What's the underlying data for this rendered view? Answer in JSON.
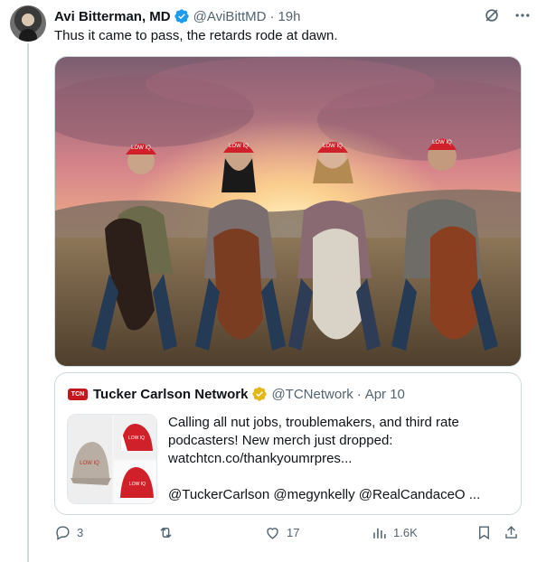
{
  "tweet": {
    "author_name": "Avi Bitterman, MD",
    "handle": "@AviBittMD",
    "separator": "·",
    "time": "19h",
    "text": "Thus it came to pass, the retards rode at dawn.",
    "image_hat_text": "LOW IQ"
  },
  "quote": {
    "logo_text": "TCN",
    "author_name": "Tucker Carlson Network",
    "handle": "@TCNetwork",
    "separator": "·",
    "date": "Apr 10",
    "text": "Calling all nut jobs, troublemakers, and third rate podcasters! New merch just dropped: watchtcn.co/thankyoumrpres...\n\n@TuckerCarlson @megynkelly @RealCandaceO ...",
    "hat_text": "LOW IQ"
  },
  "actions": {
    "replies": "3",
    "retweets": "",
    "likes": "17",
    "views": "1.6K"
  },
  "colors": {
    "verified_blue": "#1d9bf0",
    "gold_badge": "#e2b719",
    "cap_red": "#d0202a"
  }
}
